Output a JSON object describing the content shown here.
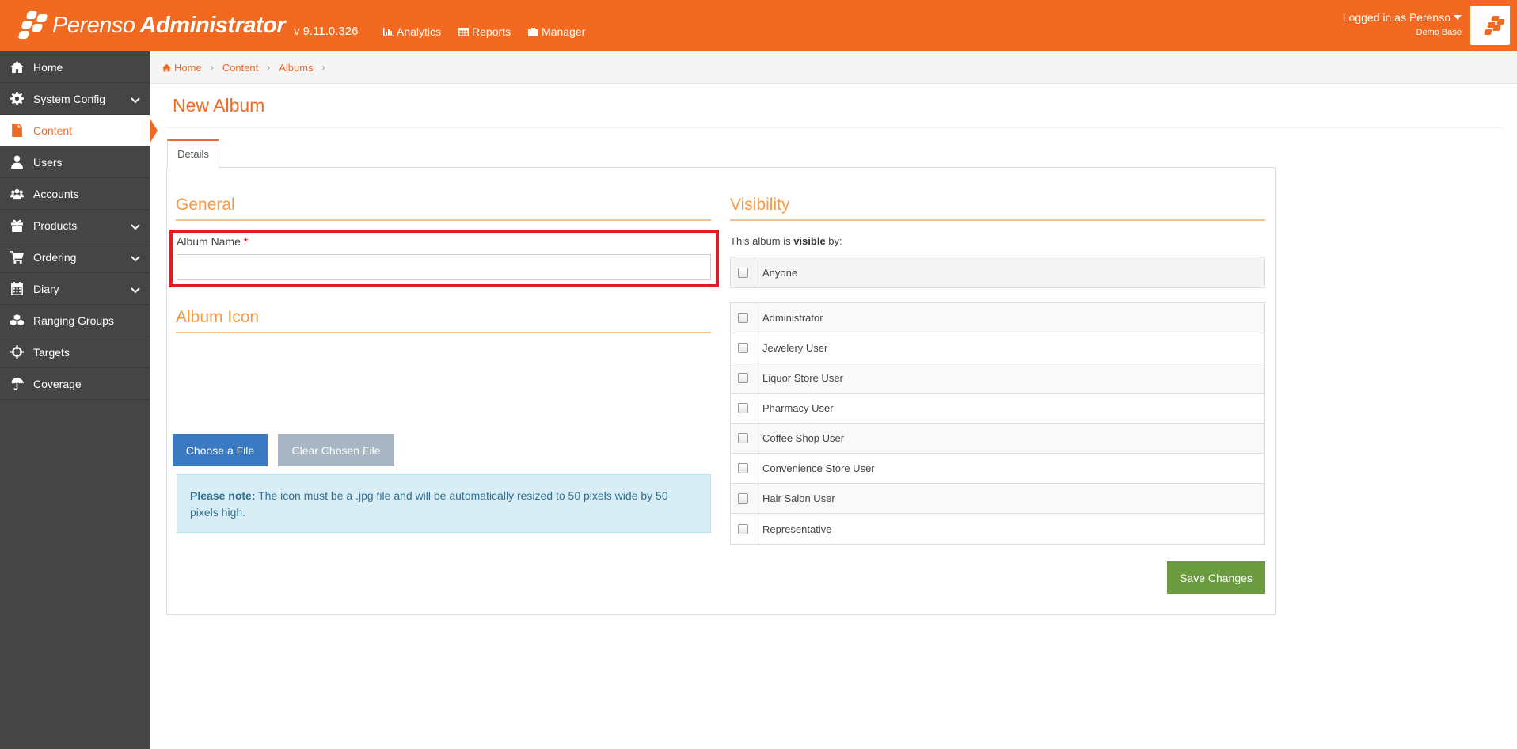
{
  "header": {
    "brand_light": "Perenso",
    "brand_bold": "Administrator",
    "version": "v 9.11.0.326",
    "nav": [
      {
        "label": "Analytics",
        "icon": "chart-icon"
      },
      {
        "label": "Reports",
        "icon": "table-icon"
      },
      {
        "label": "Manager",
        "icon": "briefcase-icon"
      }
    ],
    "user_label": "Logged in as Perenso",
    "database": "Demo Base"
  },
  "sidebar": {
    "items": [
      {
        "label": "Home",
        "icon": "home-icon",
        "expandable": false
      },
      {
        "label": "System Config",
        "icon": "gear-icon",
        "expandable": true
      },
      {
        "label": "Content",
        "icon": "file-icon",
        "expandable": false,
        "active": true
      },
      {
        "label": "Users",
        "icon": "user-icon",
        "expandable": false
      },
      {
        "label": "Accounts",
        "icon": "users-icon",
        "expandable": false
      },
      {
        "label": "Products",
        "icon": "gift-icon",
        "expandable": true
      },
      {
        "label": "Ordering",
        "icon": "cart-icon",
        "expandable": true
      },
      {
        "label": "Diary",
        "icon": "calendar-icon",
        "expandable": true
      },
      {
        "label": "Ranging Groups",
        "icon": "cubes-icon",
        "expandable": false
      },
      {
        "label": "Targets",
        "icon": "crosshairs-icon",
        "expandable": false
      },
      {
        "label": "Coverage",
        "icon": "umbrella-icon",
        "expandable": false
      }
    ]
  },
  "breadcrumb": [
    "Home",
    "Content",
    "Albums"
  ],
  "page": {
    "title": "New Album",
    "tab": "Details"
  },
  "general": {
    "title": "General",
    "album_name_label": "Album Name",
    "required_mark": "*",
    "album_name_value": ""
  },
  "album_icon": {
    "title": "Album Icon",
    "choose_label": "Choose a File",
    "clear_label": "Clear Chosen File",
    "note_bold": "Please note:",
    "note_text": " The icon must be a .jpg file and will be automatically resized to 50 pixels wide by 50 pixels high."
  },
  "visibility": {
    "title": "Visibility",
    "intro_prefix": "This album is ",
    "intro_bold": "visible",
    "intro_suffix": " by:",
    "anyone": "Anyone",
    "roles": [
      "Administrator",
      "Jewelery User",
      "Liquor Store User",
      "Pharmacy User",
      "Coffee Shop User",
      "Convenience Store User",
      "Hair Salon User",
      "Representative"
    ]
  },
  "actions": {
    "save_label": "Save Changes"
  },
  "colors": {
    "accent": "#f26a21",
    "sidebar": "#454545",
    "save": "#6a9c3f",
    "choose": "#3a7ac2"
  }
}
